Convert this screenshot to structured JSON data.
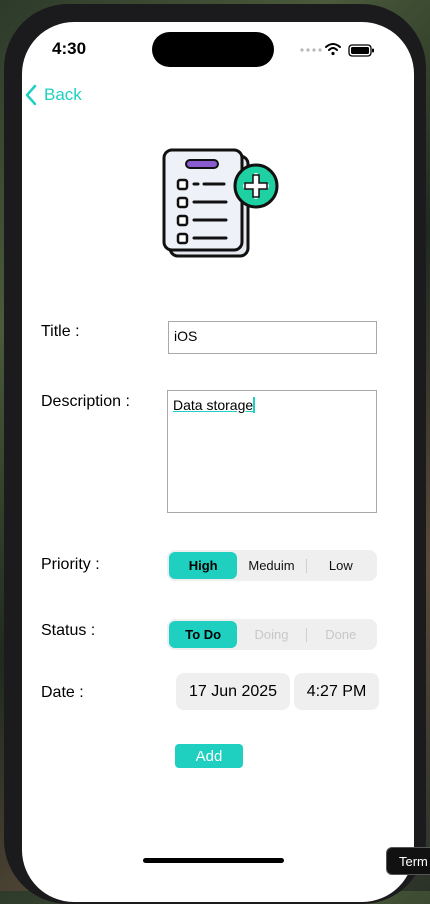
{
  "status_bar": {
    "time": "4:30"
  },
  "nav": {
    "back_label": "Back"
  },
  "form": {
    "title": {
      "label": "Title :",
      "value": "iOS"
    },
    "description": {
      "label": "Description :",
      "value": "Data storage"
    },
    "priority": {
      "label": "Priority :",
      "options": [
        "High",
        "Meduim",
        "Low"
      ],
      "selected": "High"
    },
    "status": {
      "label": "Status :",
      "options": [
        "To Do",
        "Doing",
        "Done"
      ],
      "selected": "To Do"
    },
    "date": {
      "label": "Date :",
      "date_value": "17 Jun 2025",
      "time_value": "4:27 PM"
    }
  },
  "actions": {
    "add_label": "Add"
  },
  "tooltip": {
    "text": "Term"
  },
  "colors": {
    "accent": "#1fd0c1",
    "field_bg": "#efefef",
    "border": "#a9a9a9"
  },
  "icons": [
    "chevron-left-icon",
    "task-add-icon",
    "signal-icon",
    "wifi-icon",
    "battery-icon"
  ]
}
